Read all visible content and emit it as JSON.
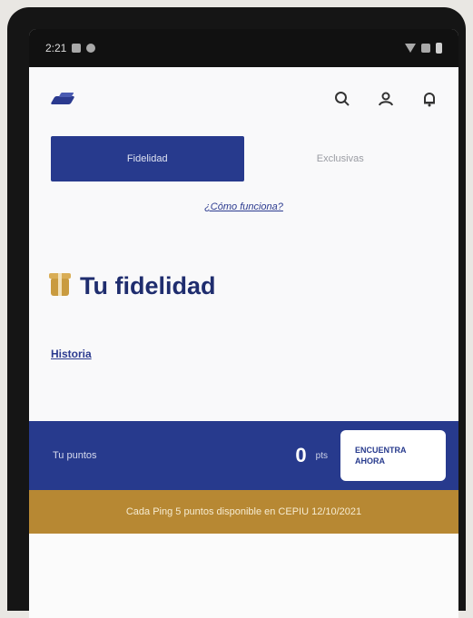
{
  "status_bar": {
    "time": "2:21",
    "icons": [
      "settings-icon",
      "message-icon",
      "wifi-icon",
      "signal-icon",
      "battery-icon"
    ]
  },
  "header": {
    "logo_icon": "brand-logo",
    "icons": [
      "search-icon",
      "user-icon",
      "bell-icon"
    ]
  },
  "tabs": [
    {
      "label": "Fidelidad",
      "active": true
    },
    {
      "label": "Exclusivas",
      "active": false
    }
  ],
  "link_text": "¿Cómo funciona?",
  "section": {
    "title": "Tu fidelidad",
    "subheading": "Historia"
  },
  "balance": {
    "label": "Tu puntos",
    "value": "0",
    "unit": "pts",
    "cta": "ENCUENTRA AHORA"
  },
  "banner": {
    "text": "Cada Ping 5 puntos disponible en CEPIU 12/10/2021"
  },
  "colors": {
    "primary": "#273a8d",
    "gold": "#b78833",
    "background": "#f9f9fa"
  }
}
